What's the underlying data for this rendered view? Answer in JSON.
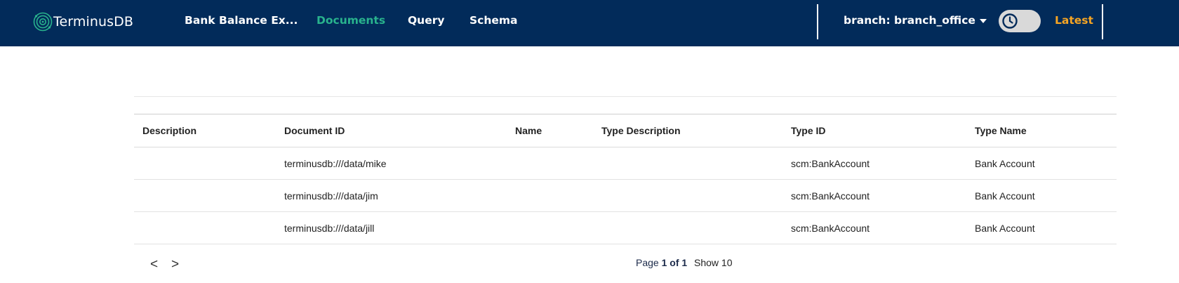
{
  "app": {
    "logo_text": "TerminusDB",
    "brand_color": "#022b5a",
    "accent_color": "#29b38d",
    "latest_color": "#f6a523"
  },
  "nav": {
    "database": "Bank Balance Ex...",
    "documents": "Documents",
    "query": "Query",
    "schema": "Schema",
    "active": "Documents"
  },
  "branch": {
    "label": "branch: branch_office",
    "icon": "caret-down-icon"
  },
  "time_toggle": {
    "icon": "clock-icon",
    "state": "off"
  },
  "latest_label": "Latest",
  "table": {
    "headers": [
      "Description",
      "Document ID",
      "Name",
      "Type Description",
      "Type ID",
      "Type Name"
    ],
    "rows": [
      [
        "",
        "terminusdb:///data/mike",
        "",
        "",
        "scm:BankAccount",
        "Bank Account"
      ],
      [
        "",
        "terminusdb:///data/jim",
        "",
        "",
        "scm:BankAccount",
        "Bank Account"
      ],
      [
        "",
        "terminusdb:///data/jill",
        "",
        "",
        "scm:BankAccount",
        "Bank Account"
      ]
    ]
  },
  "pagination": {
    "prev": "<",
    "next": ">",
    "page_prefix": "Page",
    "page_current": "1",
    "page_of": "of",
    "page_total": "1",
    "show_label": "Show 10"
  }
}
